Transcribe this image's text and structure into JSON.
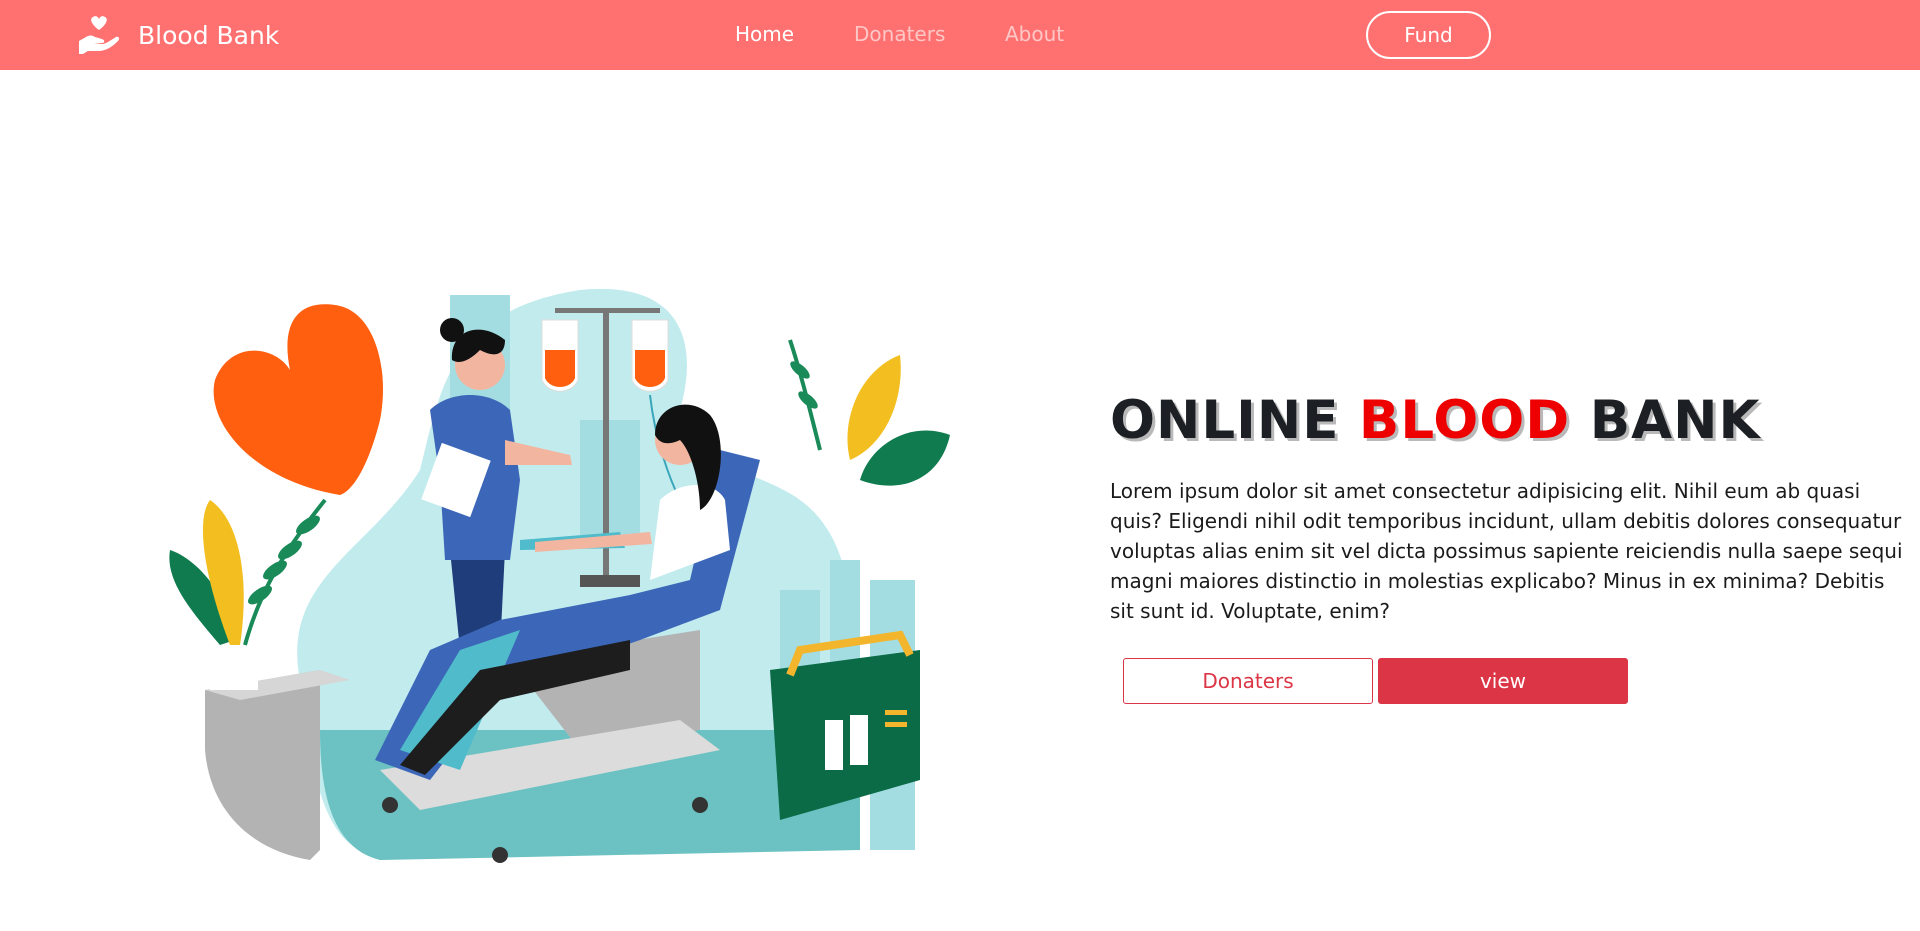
{
  "navbar": {
    "brand": {
      "label": "Blood Bank",
      "icon": "hand-heart-icon"
    },
    "links": [
      {
        "label": "Home",
        "state": "active"
      },
      {
        "label": "Donaters",
        "state": "inactive"
      },
      {
        "label": "About",
        "state": "inactive"
      }
    ],
    "fund_label": "Fund"
  },
  "hero": {
    "title_parts": [
      "ONLINE",
      "BLOOD",
      "BANK"
    ],
    "body": "Lorem ipsum dolor sit amet consectetur adipisicing elit. Nihil eum ab quasi quis? Eligendi nihil odit temporibus incidunt, ullam debitis dolores consequatur voluptas alias enim sit vel dicta possimus sapiente reiciendis nulla saepe sequi magni maiores distinctio in molestias explicabo? Minus in ex minima? Debitis sit sunt id. Voluptate, enim?",
    "buttons": {
      "donaters": "Donaters",
      "view": "view"
    },
    "illustration": "blood-donation-illustration"
  },
  "colors": {
    "navbar": "#ff7171",
    "title_highlight": "#ee0000",
    "button_red": "#dc3545",
    "heart": "#ff5f0f",
    "scene_teal": "#c2ebee"
  }
}
